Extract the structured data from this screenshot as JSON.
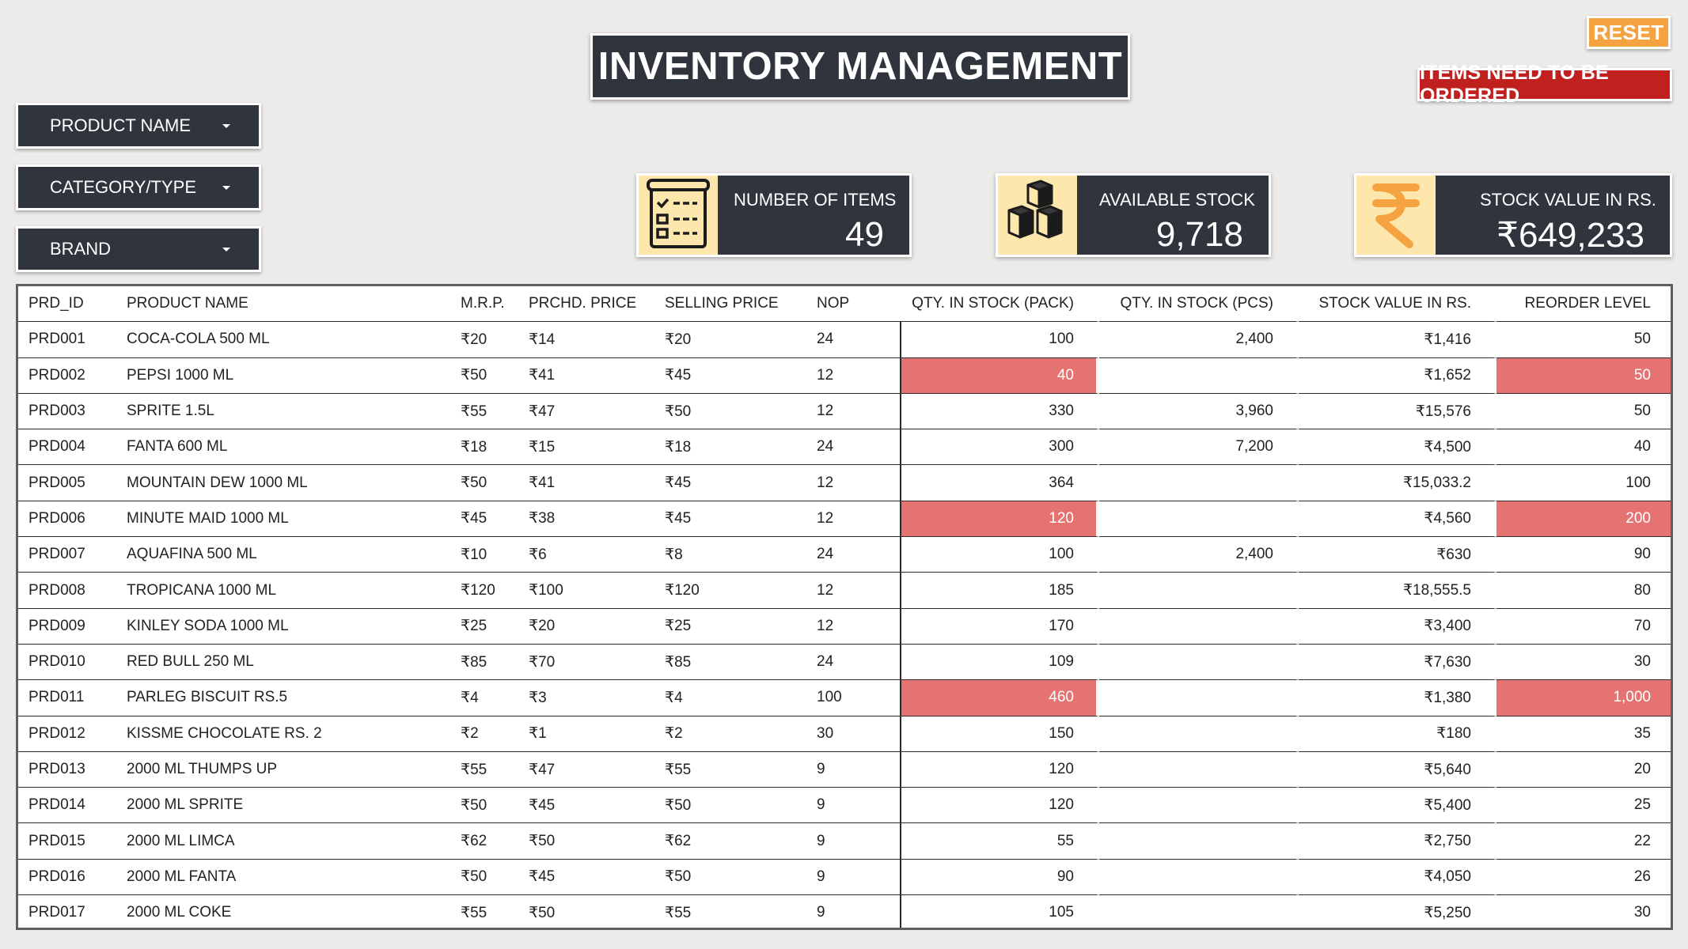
{
  "header": {
    "title": "INVENTORY MANAGEMENT",
    "reset_label": "RESET",
    "order_label": "ITEMS NEED TO BE ORDERED"
  },
  "filters": [
    {
      "label": "PRODUCT NAME"
    },
    {
      "label": "CATEGORY/TYPE"
    },
    {
      "label": "BRAND"
    }
  ],
  "kpis": [
    {
      "label": "NUMBER OF ITEMS",
      "value": "49",
      "icon": "checklist-icon"
    },
    {
      "label": "AVAILABLE STOCK",
      "value": "9,718",
      "icon": "boxes-icon"
    },
    {
      "label": "STOCK VALUE IN RS.",
      "value": "₹649,233",
      "icon": "rupee-icon"
    }
  ],
  "colors": {
    "dark": "#30343c",
    "accent_orange": "#f5a340",
    "alert_red": "#c1211e",
    "highlight": "#e47371",
    "icon_bg": "#fde7ad"
  },
  "table": {
    "columns": [
      "PRD_ID",
      "PRODUCT NAME",
      "M.R.P.",
      "PRCHD. PRICE",
      "SELLING PRICE",
      "NOP",
      "QTY. IN STOCK (PACK)",
      "QTY. IN STOCK (PCS)",
      "STOCK VALUE IN RS.",
      "REORDER LEVEL"
    ],
    "rows": [
      {
        "id": "PRD001",
        "name": "COCA-COLA 500 ML",
        "mrp": "₹20",
        "prchd": "₹14",
        "sell": "₹20",
        "nop": "24",
        "pack": "100",
        "pcs": "2,400",
        "value": "₹1,416",
        "reorder": "50",
        "low": false
      },
      {
        "id": "PRD002",
        "name": "PEPSI 1000 ML",
        "mrp": "₹50",
        "prchd": "₹41",
        "sell": "₹45",
        "nop": "12",
        "pack": "40",
        "pcs": "",
        "value": "₹1,652",
        "reorder": "50",
        "low": true
      },
      {
        "id": "PRD003",
        "name": "SPRITE 1.5L",
        "mrp": "₹55",
        "prchd": "₹47",
        "sell": "₹50",
        "nop": "12",
        "pack": "330",
        "pcs": "3,960",
        "value": "₹15,576",
        "reorder": "50",
        "low": false
      },
      {
        "id": "PRD004",
        "name": "FANTA 600 ML",
        "mrp": "₹18",
        "prchd": "₹15",
        "sell": "₹18",
        "nop": "24",
        "pack": "300",
        "pcs": "7,200",
        "value": "₹4,500",
        "reorder": "40",
        "low": false
      },
      {
        "id": "PRD005",
        "name": "MOUNTAIN DEW 1000 ML",
        "mrp": "₹50",
        "prchd": "₹41",
        "sell": "₹45",
        "nop": "12",
        "pack": "364",
        "pcs": "",
        "value": "₹15,033.2",
        "reorder": "100",
        "low": false
      },
      {
        "id": "PRD006",
        "name": "MINUTE MAID 1000 ML",
        "mrp": "₹45",
        "prchd": "₹38",
        "sell": "₹45",
        "nop": "12",
        "pack": "120",
        "pcs": "",
        "value": "₹4,560",
        "reorder": "200",
        "low": true
      },
      {
        "id": "PRD007",
        "name": "AQUAFINA 500 ML",
        "mrp": "₹10",
        "prchd": "₹6",
        "sell": "₹8",
        "nop": "24",
        "pack": "100",
        "pcs": "2,400",
        "value": "₹630",
        "reorder": "90",
        "low": false
      },
      {
        "id": "PRD008",
        "name": "TROPICANA 1000 ML",
        "mrp": "₹120",
        "prchd": "₹100",
        "sell": "₹120",
        "nop": "12",
        "pack": "185",
        "pcs": "",
        "value": "₹18,555.5",
        "reorder": "80",
        "low": false
      },
      {
        "id": "PRD009",
        "name": "KINLEY SODA 1000 ML",
        "mrp": "₹25",
        "prchd": "₹20",
        "sell": "₹25",
        "nop": "12",
        "pack": "170",
        "pcs": "",
        "value": "₹3,400",
        "reorder": "70",
        "low": false
      },
      {
        "id": "PRD010",
        "name": "RED BULL 250 ML",
        "mrp": "₹85",
        "prchd": "₹70",
        "sell": "₹85",
        "nop": "24",
        "pack": "109",
        "pcs": "",
        "value": "₹7,630",
        "reorder": "30",
        "low": false
      },
      {
        "id": "PRD011",
        "name": "PARLEG BISCUIT RS.5",
        "mrp": "₹4",
        "prchd": "₹3",
        "sell": "₹4",
        "nop": "100",
        "pack": "460",
        "pcs": "",
        "value": "₹1,380",
        "reorder": "1,000",
        "low": true
      },
      {
        "id": "PRD012",
        "name": "KISSME CHOCOLATE RS. 2",
        "mrp": "₹2",
        "prchd": "₹1",
        "sell": "₹2",
        "nop": "30",
        "pack": "150",
        "pcs": "",
        "value": "₹180",
        "reorder": "35",
        "low": false
      },
      {
        "id": "PRD013",
        "name": "2000 ML THUMPS UP",
        "mrp": "₹55",
        "prchd": "₹47",
        "sell": "₹55",
        "nop": "9",
        "pack": "120",
        "pcs": "",
        "value": "₹5,640",
        "reorder": "20",
        "low": false
      },
      {
        "id": "PRD014",
        "name": "2000 ML SPRITE",
        "mrp": "₹50",
        "prchd": "₹45",
        "sell": "₹50",
        "nop": "9",
        "pack": "120",
        "pcs": "",
        "value": "₹5,400",
        "reorder": "25",
        "low": false
      },
      {
        "id": "PRD015",
        "name": "2000 ML LIMCA",
        "mrp": "₹62",
        "prchd": "₹50",
        "sell": "₹62",
        "nop": "9",
        "pack": "55",
        "pcs": "",
        "value": "₹2,750",
        "reorder": "22",
        "low": false
      },
      {
        "id": "PRD016",
        "name": "2000 ML FANTA",
        "mrp": "₹50",
        "prchd": "₹45",
        "sell": "₹50",
        "nop": "9",
        "pack": "90",
        "pcs": "",
        "value": "₹4,050",
        "reorder": "26",
        "low": false
      },
      {
        "id": "PRD017",
        "name": "2000 ML COKE",
        "mrp": "₹55",
        "prchd": "₹50",
        "sell": "₹55",
        "nop": "9",
        "pack": "105",
        "pcs": "",
        "value": "₹5,250",
        "reorder": "30",
        "low": false
      }
    ]
  }
}
